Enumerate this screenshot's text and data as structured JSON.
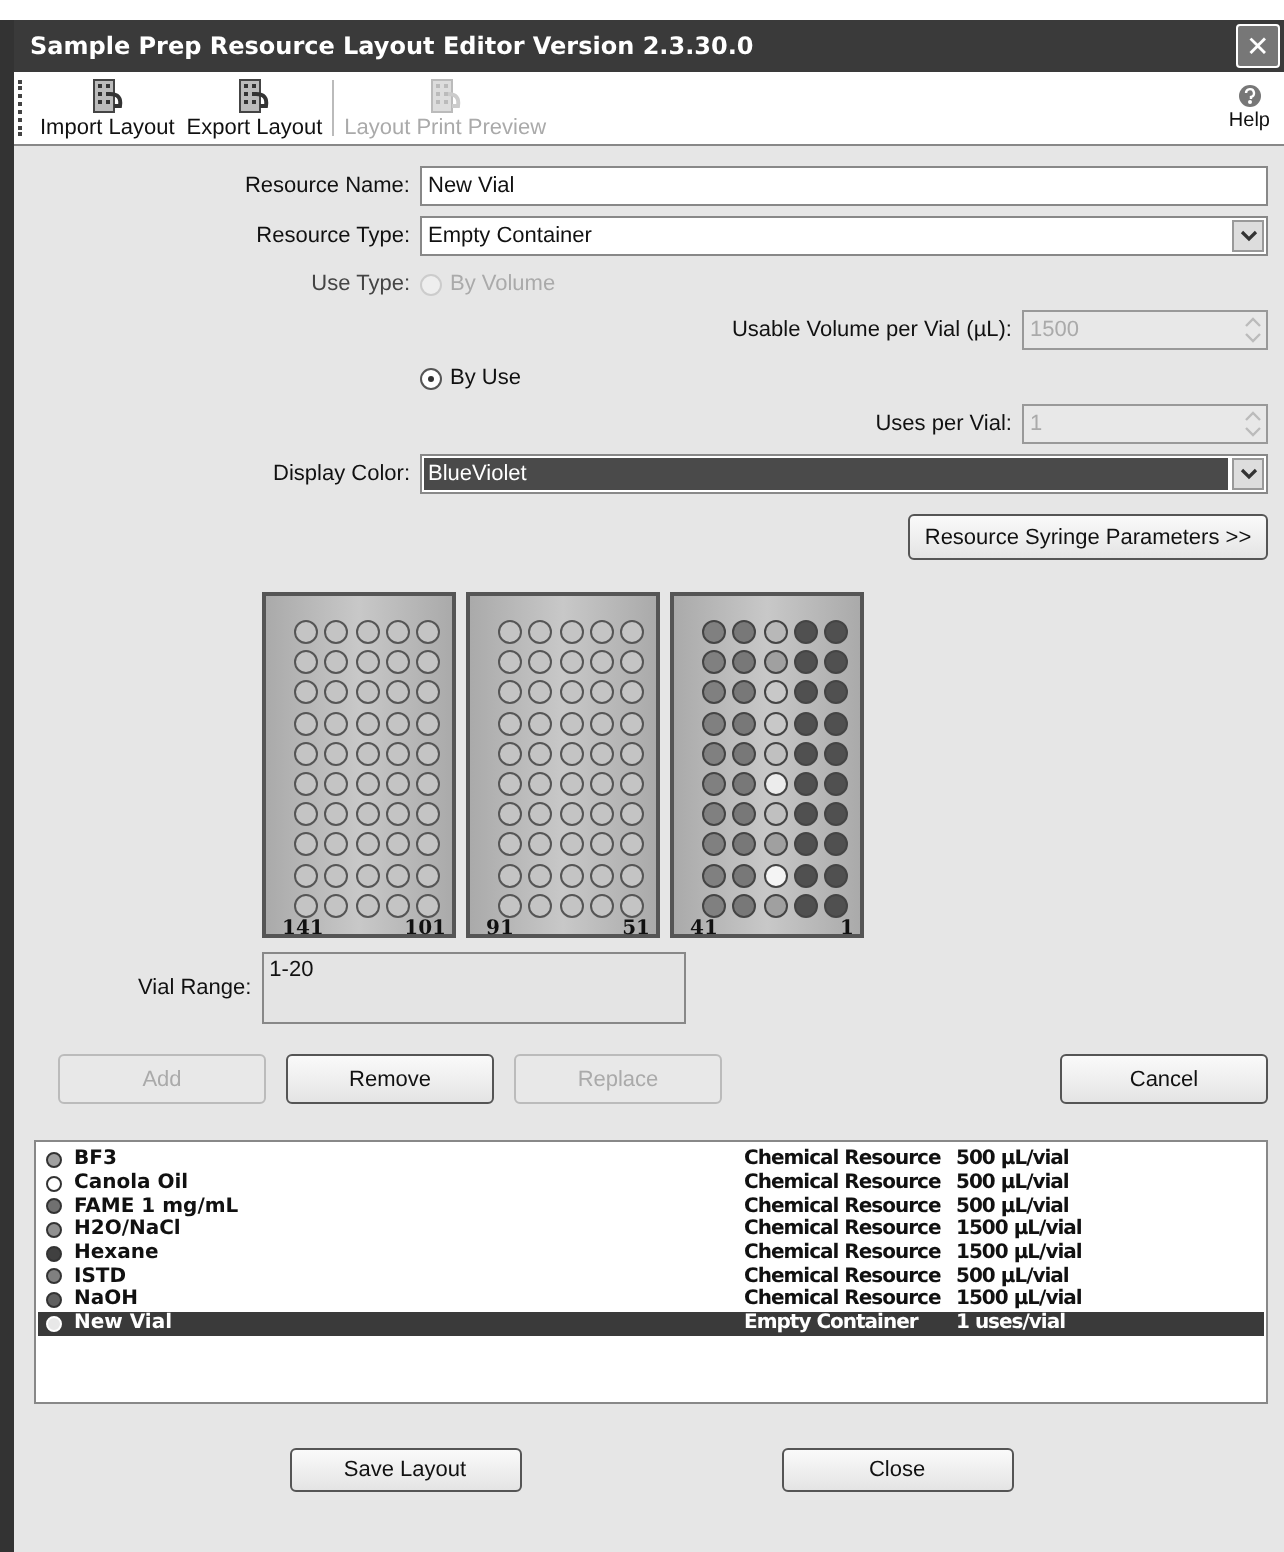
{
  "window": {
    "title": "Sample Prep Resource Layout Editor Version 2.3.30.0",
    "close": "✕"
  },
  "toolbar": [
    {
      "label": "Import Layout",
      "disabled": false
    },
    {
      "label": "Export Layout",
      "disabled": false
    },
    {
      "label": "Layout Print Preview",
      "disabled": true
    }
  ],
  "help": "Help",
  "resource_name": {
    "label": "Resource Name:",
    "value": "New Vial"
  },
  "resource_type": {
    "label": "Resource Type:",
    "value": "Empty Container"
  },
  "use_type": {
    "label": "Use Type:",
    "options": [
      {
        "label": "By Volume",
        "selected": false,
        "disabled": true,
        "spin_label": "Usable Volume per Vial (µL):",
        "spin_value": "1500"
      },
      {
        "label": "By Use",
        "selected": true,
        "disabled": false,
        "spin_label": "Uses per Vial:",
        "spin_value": "1"
      }
    ]
  },
  "display_color": {
    "label": "Display Color:",
    "value": "BlueViolet"
  },
  "syringe_button": "Resource Syringe Parameters >>",
  "racks": [
    {
      "first": "141",
      "last": "101"
    },
    {
      "first": "91",
      "last": "51"
    },
    {
      "first": "41",
      "last": "1",
      "vials": [
        [
          {
            "color": "#808080"
          },
          {
            "color": "#787878"
          },
          {
            "color": "#b8b8b8"
          },
          {
            "color": "#505050"
          },
          {
            "color": "#505050"
          }
        ],
        [
          {
            "color": "#808080"
          },
          {
            "color": "#787878"
          },
          {
            "color": "#a0a0a0"
          },
          {
            "color": "#505050"
          },
          {
            "color": "#505050"
          }
        ],
        [
          {
            "color": "#808080"
          },
          {
            "color": "#787878"
          },
          {
            "color": "#c8c8c8"
          },
          {
            "color": "#505050"
          },
          {
            "color": "#505050"
          }
        ],
        [
          {
            "color": "#808080"
          },
          {
            "color": "#787878"
          },
          {
            "color": "#c8c8c8"
          },
          {
            "color": "#505050"
          },
          {
            "color": "#505050"
          }
        ],
        [
          {
            "color": "#808080"
          },
          {
            "color": "#787878"
          },
          {
            "color": "#c0c0c0"
          },
          {
            "color": "#505050"
          },
          {
            "color": "#505050"
          }
        ],
        [
          {
            "color": "#808080"
          },
          {
            "color": "#787878"
          },
          {
            "color": "#ececec"
          },
          {
            "color": "#505050"
          },
          {
            "color": "#505050"
          }
        ],
        [
          {
            "color": "#808080"
          },
          {
            "color": "#787878"
          },
          {
            "color": "#c0c0c0"
          },
          {
            "color": "#505050"
          },
          {
            "color": "#505050"
          }
        ],
        [
          {
            "color": "#808080"
          },
          {
            "color": "#787878"
          },
          {
            "color": "#a0a0a0"
          },
          {
            "color": "#505050"
          },
          {
            "color": "#505050"
          }
        ],
        [
          {
            "color": "#808080"
          },
          {
            "color": "#787878"
          },
          {
            "color": "#f4f4f4"
          },
          {
            "color": "#505050"
          },
          {
            "color": "#505050"
          }
        ],
        [
          {
            "color": "#808080"
          },
          {
            "color": "#787878"
          },
          {
            "color": "#a0a0a0"
          },
          {
            "color": "#505050"
          },
          {
            "color": "#505050"
          }
        ]
      ]
    }
  ],
  "vial_range": {
    "label": "Vial Range:",
    "value": "1-20"
  },
  "actions": [
    {
      "label": "Add",
      "disabled": true
    },
    {
      "label": "Remove",
      "disabled": false
    },
    {
      "label": "Replace",
      "disabled": true
    }
  ],
  "cancel": "Cancel",
  "resources": [
    {
      "name": "BF3",
      "type": "Chemical Resource",
      "amount": "500 µL/vial",
      "color": "#a0a0a0",
      "selected": false
    },
    {
      "name": "Canola Oil",
      "type": "Chemical Resource",
      "amount": "500 µL/vial",
      "color": "#ffffff",
      "selected": false
    },
    {
      "name": "FAME 1 mg/mL",
      "type": "Chemical Resource",
      "amount": "500 µL/vial",
      "color": "#707070",
      "selected": false
    },
    {
      "name": "H2O/NaCl",
      "type": "Chemical Resource",
      "amount": "1500 µL/vial",
      "color": "#909090",
      "selected": false
    },
    {
      "name": "Hexane",
      "type": "Chemical Resource",
      "amount": "1500 µL/vial",
      "color": "#404040",
      "selected": false
    },
    {
      "name": "ISTD",
      "type": "Chemical Resource",
      "amount": "500 µL/vial",
      "color": "#808080",
      "selected": false
    },
    {
      "name": "NaOH",
      "type": "Chemical Resource",
      "amount": "1500 µL/vial",
      "color": "#606060",
      "selected": false
    },
    {
      "name": "New Vial",
      "type": "Empty Container",
      "amount": "1 uses/vial",
      "color": "#e8e8e8",
      "selected": true
    }
  ],
  "footer": [
    "Save Layout",
    "Close"
  ]
}
